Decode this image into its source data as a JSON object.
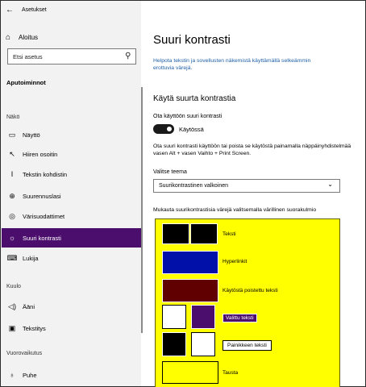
{
  "window": {
    "back_glyph": "←",
    "title": "Asetukset"
  },
  "sidebar": {
    "home_label": "Aloitus",
    "search_placeholder": "Etsi asetus",
    "section_title": "Aputoiminnot",
    "groups": [
      "Näkö",
      "Kuulo",
      "Vuorovaikutus"
    ],
    "items": [
      {
        "label": "Näyttö",
        "icon": "monitor-icon"
      },
      {
        "label": "Hiiren osoitin",
        "icon": "mouse-pointer-icon"
      },
      {
        "label": "Tekstin kohdistin",
        "icon": "text-cursor-icon"
      },
      {
        "label": "Suurennuslasi",
        "icon": "magnifier-icon"
      },
      {
        "label": "Värisuodattimet",
        "icon": "color-filter-icon"
      },
      {
        "label": "Suuri kontrasti",
        "icon": "high-contrast-icon",
        "selected": true
      },
      {
        "label": "Lukija",
        "icon": "narrator-icon"
      },
      {
        "label": "Ääni",
        "icon": "speaker-icon"
      },
      {
        "label": "Tekstitys",
        "icon": "captions-icon"
      },
      {
        "label": "Puhe",
        "icon": "microphone-icon"
      }
    ]
  },
  "main": {
    "title": "Suuri kontrasti",
    "intro": "Helpota tekstin ja sovellusten näkemistä käyttämällä selkeämmin erottuvia värejä.",
    "section_title": "Käytä suurta kontrastia",
    "toggle_label": "Ota käyttöön suuri kontrasti",
    "toggle_state": "Käytössä",
    "toggle_on": true,
    "shortcut_desc": "Ota suuri kontrasti käyttöön tai poista se käytöstä painamalla näppäinyhdistelmää vasen Alt + vasen Vaihto + Print Screen.",
    "theme_label": "Valitse teema",
    "theme_value": "Suurikontrastinen valkoinen",
    "customize_desc": "Mukauta suurikontrastisia värejä valitsemalla värillinen suorakulmio",
    "preview": {
      "text": "Teksti",
      "hyperlinks": "Hyperlinkit",
      "disabled_text": "Käytöstä poistettu teksti",
      "selected_text": "Valittu teksti",
      "button_text": "Painikkeen teksti",
      "background": "Tausta"
    },
    "colors": {
      "text": "#000000",
      "hyperlinks": "#0010a8",
      "disabled_text": "#600000",
      "selected_text_bg": "#ffffff",
      "selected_text_fg": "#4c0e6d",
      "button_bg": "#000000",
      "button_fg": "#ffffff",
      "background": "#ffff00"
    }
  }
}
